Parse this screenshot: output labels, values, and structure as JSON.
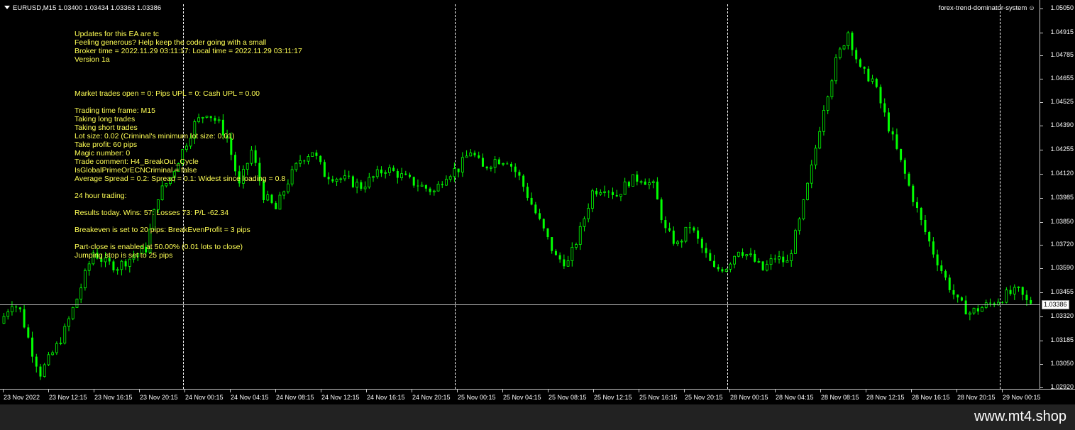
{
  "header": {
    "symbol_line": "EURUSD,M15  1.03400 1.03434 1.03363 1.03386",
    "ea_name": "forex-trend-dominator-system",
    "ea_icon": "smiley-icon"
  },
  "info_lines": [
    "Updates for this EA are tc",
    "Feeling generous? Help keep the coder going with a small",
    "Broker time = 2022.11.29 03:11:17: Local time = 2022.11.29 03:11:17",
    "Version 1a",
    "",
    "",
    "",
    "Market trades open = 0: Pips UPL = 0: Cash UPL = 0.00",
    "",
    "Trading time frame: M15",
    "Taking long trades",
    "Taking short trades",
    "Lot size: 0.02 (Criminal's minimum lot size: 0.01)",
    "Take profit: 60 pips",
    "Magic number: 0",
    "Trade comment: H4_BreakOut_Cycle",
    "IsGlobalPrimeOrECNCriminal = false",
    "Average Spread = 0.2: Spread = 0.1: Widest since loading = 0.8",
    "",
    "24 hour trading:",
    "",
    "Results today. Wins: 57: Losses 73: P/L -62.34",
    "",
    "Breakeven is set to 20 pips: BreakEvenProfit = 3 pips",
    "",
    "Part-close is enabled at 50.00% (0.01 lots to close)",
    "Jumping stop is set to 25 pips"
  ],
  "price_axis": {
    "labels": [
      "1.05050",
      "1.04915",
      "1.04785",
      "1.04655",
      "1.04525",
      "1.04390",
      "1.04255",
      "1.04120",
      "1.03985",
      "1.03850",
      "1.03720",
      "1.03590",
      "1.03455",
      "1.03320",
      "1.03185",
      "1.03050",
      "1.02920"
    ],
    "current_price": "1.03386"
  },
  "time_axis": {
    "labels": [
      "23 Nov 2022",
      "23 Nov 12:15",
      "23 Nov 16:15",
      "23 Nov 20:15",
      "24 Nov 00:15",
      "24 Nov 04:15",
      "24 Nov 08:15",
      "24 Nov 12:15",
      "24 Nov 16:15",
      "24 Nov 20:15",
      "25 Nov 00:15",
      "25 Nov 04:15",
      "25 Nov 08:15",
      "25 Nov 12:15",
      "25 Nov 16:15",
      "25 Nov 20:15",
      "28 Nov 00:15",
      "28 Nov 04:15",
      "28 Nov 08:15",
      "28 Nov 12:15",
      "28 Nov 16:15",
      "28 Nov 20:15",
      "29 Nov 00:15"
    ]
  },
  "chart_data": {
    "type": "candlestick",
    "symbol": "EURUSD",
    "timeframe": "M15",
    "ylim": [
      1.0292,
      1.0505
    ],
    "current_price": 1.03386,
    "candle_color": "#00ff00",
    "price_path": [
      [
        0,
        1.0328
      ],
      [
        3,
        1.034
      ],
      [
        5,
        1.0335
      ],
      [
        8,
        1.0312
      ],
      [
        10,
        1.03
      ],
      [
        14,
        1.0315
      ],
      [
        16,
        1.0324
      ],
      [
        19,
        1.0342
      ],
      [
        23,
        1.0368
      ],
      [
        26,
        1.0362
      ],
      [
        29,
        1.036
      ],
      [
        33,
        1.0366
      ],
      [
        36,
        1.037
      ],
      [
        39,
        1.04
      ],
      [
        42,
        1.041
      ],
      [
        45,
        1.0425
      ],
      [
        48,
        1.044
      ],
      [
        51,
        1.0447
      ],
      [
        54,
        1.044
      ],
      [
        56,
        1.0432
      ],
      [
        59,
        1.0405
      ],
      [
        62,
        1.0425
      ],
      [
        65,
        1.04
      ],
      [
        68,
        1.0392
      ],
      [
        71,
        1.0408
      ],
      [
        74,
        1.042
      ],
      [
        77,
        1.0425
      ],
      [
        80,
        1.0412
      ],
      [
        83,
        1.041
      ],
      [
        86,
        1.0408
      ],
      [
        89,
        1.0405
      ],
      [
        92,
        1.041
      ],
      [
        95,
        1.0415
      ],
      [
        98,
        1.0412
      ],
      [
        101,
        1.0408
      ],
      [
        104,
        1.0405
      ],
      [
        107,
        1.0402
      ],
      [
        110,
        1.0412
      ],
      [
        113,
        1.0415
      ],
      [
        116,
        1.0425
      ],
      [
        119,
        1.0415
      ],
      [
        122,
        1.042
      ],
      [
        125,
        1.042
      ],
      [
        128,
        1.041
      ],
      [
        131,
        1.0395
      ],
      [
        134,
        1.038
      ],
      [
        137,
        1.0365
      ],
      [
        140,
        1.0362
      ],
      [
        143,
        1.038
      ],
      [
        146,
        1.0402
      ],
      [
        149,
        1.0405
      ],
      [
        152,
        1.04
      ],
      [
        155,
        1.0408
      ],
      [
        158,
        1.041
      ],
      [
        161,
        1.0405
      ],
      [
        164,
        1.038
      ],
      [
        167,
        1.0372
      ],
      [
        170,
        1.0383
      ],
      [
        173,
        1.037
      ],
      [
        176,
        1.0358
      ],
      [
        179,
        1.036
      ],
      [
        182,
        1.037
      ],
      [
        185,
        1.0365
      ],
      [
        188,
        1.0358
      ],
      [
        191,
        1.0365
      ],
      [
        194,
        1.0362
      ],
      [
        197,
        1.0385
      ],
      [
        200,
        1.0415
      ],
      [
        203,
        1.045
      ],
      [
        206,
        1.0475
      ],
      [
        209,
        1.0492
      ],
      [
        212,
        1.047
      ],
      [
        215,
        1.0465
      ],
      [
        218,
        1.0445
      ],
      [
        221,
        1.0425
      ],
      [
        224,
        1.0405
      ],
      [
        227,
        1.0385
      ],
      [
        230,
        1.0368
      ],
      [
        233,
        1.0353
      ],
      [
        236,
        1.034
      ],
      [
        239,
        1.0334
      ],
      [
        242,
        1.0337
      ],
      [
        245,
        1.034
      ],
      [
        248,
        1.0344
      ],
      [
        251,
        1.0346
      ],
      [
        253,
        1.034
      ]
    ]
  }
}
